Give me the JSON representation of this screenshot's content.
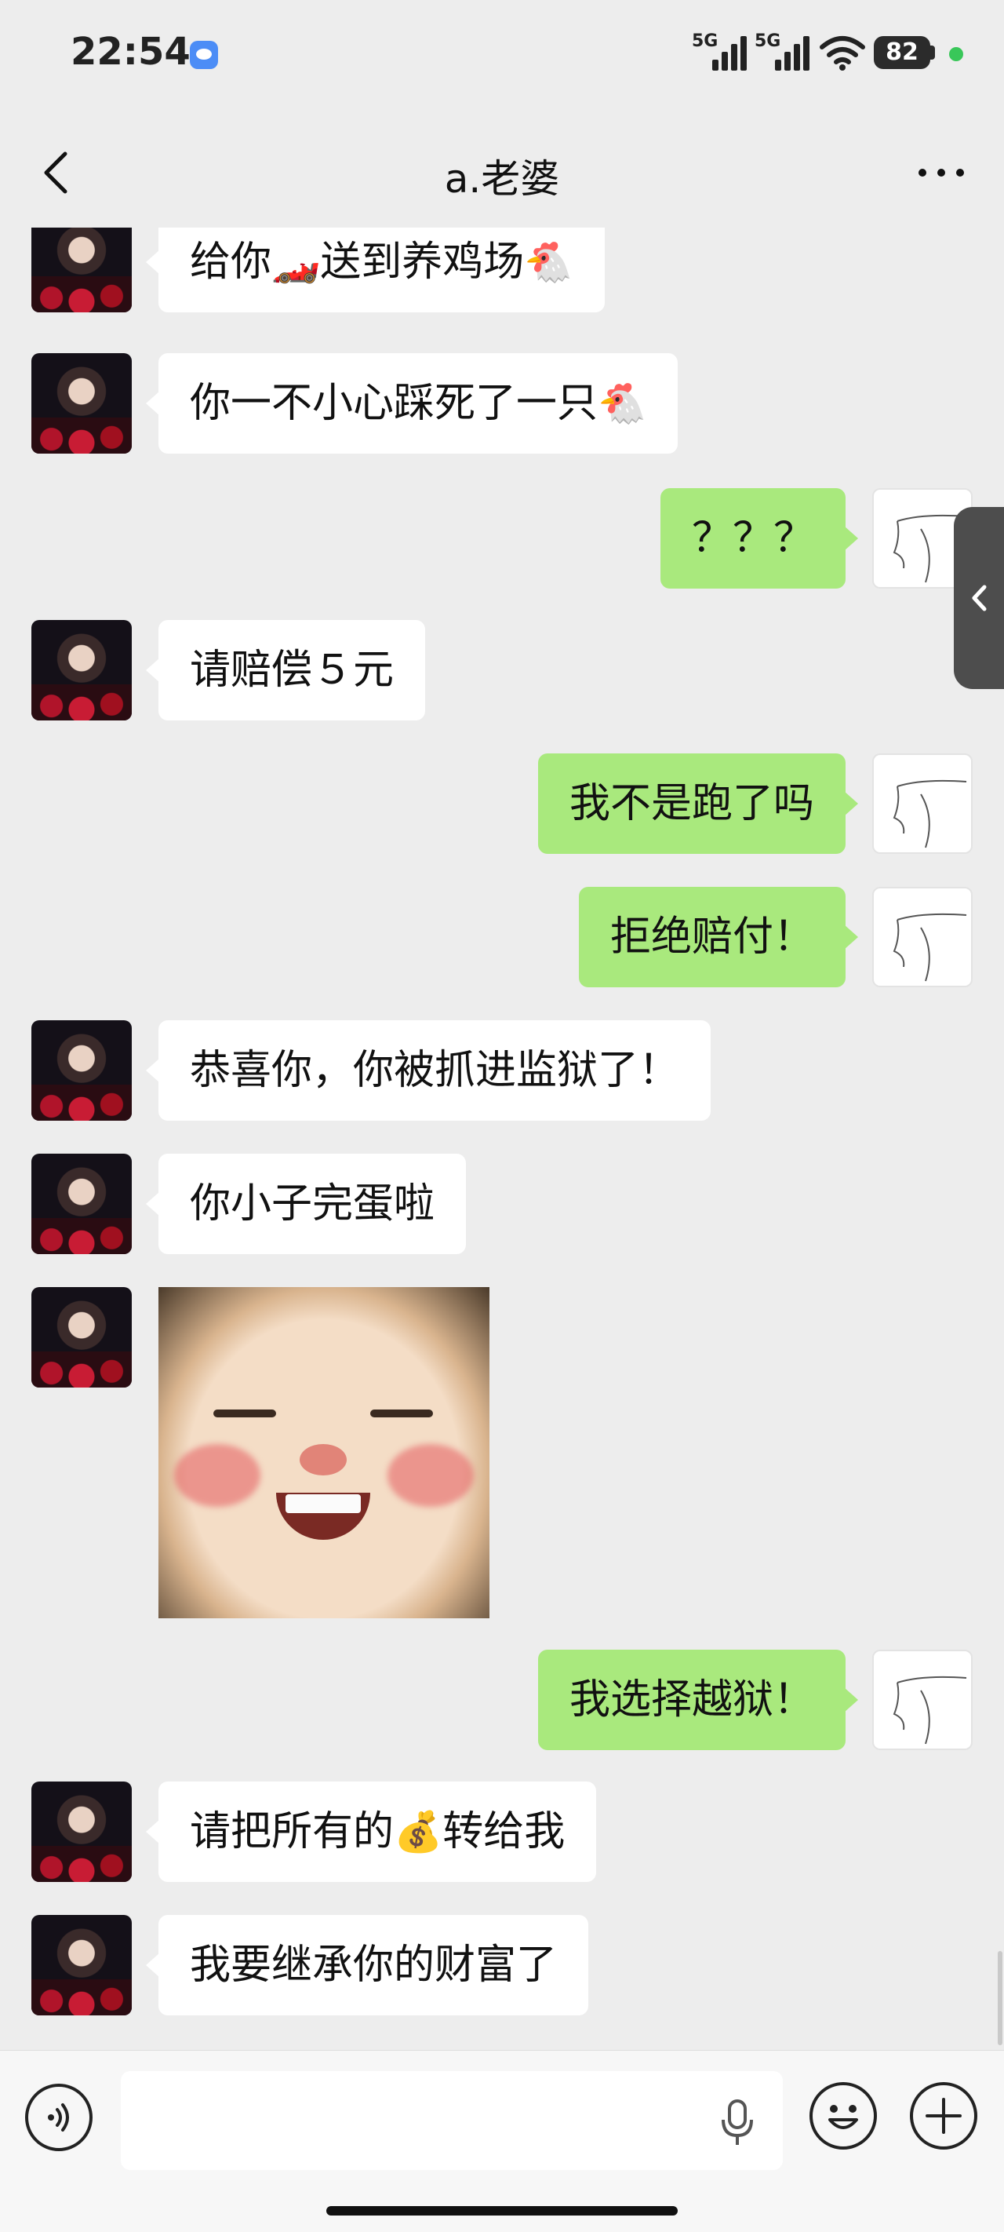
{
  "status_bar": {
    "time": "22:54",
    "network_1": "5G",
    "network_2": "5G",
    "battery": "82",
    "icons": [
      "wechat-icon",
      "signal-icon",
      "signal-icon",
      "wifi-icon",
      "battery-icon"
    ]
  },
  "header": {
    "title": "a.老婆",
    "back_icon": "chevron-left-icon",
    "more_icon": "more-dots-icon"
  },
  "messages": [
    {
      "side": "left",
      "text": "给你",
      "emoji": "🏎️",
      "text2": "送到养鸡场",
      "emoji2": "🐔"
    },
    {
      "side": "left",
      "text": "你一不小心踩死了一只",
      "emoji": "🐔"
    },
    {
      "side": "right",
      "text": "？？？"
    },
    {
      "side": "left",
      "text": "请赔偿５元"
    },
    {
      "side": "right",
      "text": "我不是跑了吗"
    },
    {
      "side": "right",
      "text": "拒绝赔付！"
    },
    {
      "side": "left",
      "text": "恭喜你，你被抓进监狱了！"
    },
    {
      "side": "left",
      "text": "你小子完蛋啦"
    },
    {
      "side": "left",
      "type": "sticker",
      "sticker": "laughing-baby-sticker"
    },
    {
      "side": "right",
      "text": "我选择越狱！"
    },
    {
      "side": "left",
      "text": "请把所有的",
      "emoji": "💰",
      "text2": "转给我"
    },
    {
      "side": "left",
      "text": "我要继承你的财富了"
    }
  ],
  "input_bar": {
    "value": "",
    "placeholder": "",
    "icons": [
      "voice-icon",
      "microphone-icon",
      "emoji-icon",
      "plus-icon"
    ]
  },
  "colors": {
    "background": "#ededed",
    "outgoing_bubble": "#a9e97d",
    "incoming_bubble": "#ffffff"
  }
}
